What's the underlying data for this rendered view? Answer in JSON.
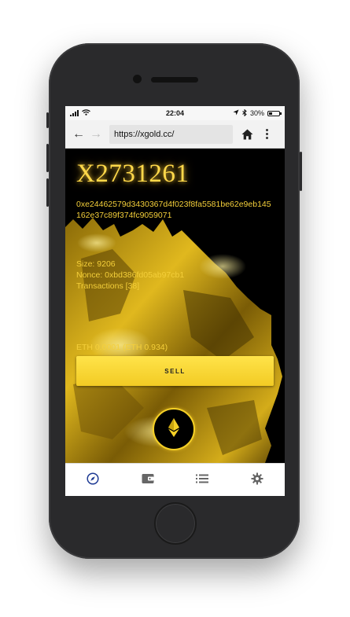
{
  "status": {
    "time": "22:04",
    "battery_pct": "30%",
    "battery_level": 0.3
  },
  "browser": {
    "url": "https://xgold.cc/"
  },
  "block": {
    "title": "X2731261",
    "hash": "0xe24462579d3430367d4f023f8fa5581be62e9eb145162e37c89f374fc9059071",
    "size": "Size: 9206",
    "nonce": "Nonce: 0xbd386fd05ab97cb1",
    "transactions": "Transactions [38]",
    "eth": "ETH 0.0001 (ETH 0.934)"
  },
  "actions": {
    "sell_label": "SELL"
  },
  "tabbar": {
    "items": [
      {
        "icon": "compass-icon",
        "active": true
      },
      {
        "icon": "wallet-icon",
        "active": false
      },
      {
        "icon": "list-icon",
        "active": false
      },
      {
        "icon": "gear-icon",
        "active": false
      }
    ]
  },
  "colors": {
    "gold": "#f4cf3a",
    "accent_blue": "#1f3b94"
  }
}
